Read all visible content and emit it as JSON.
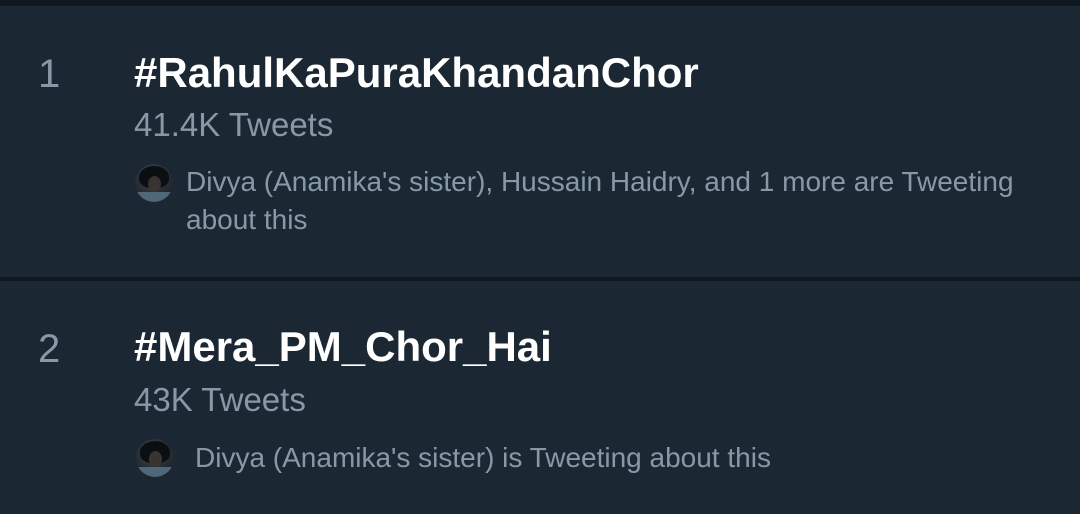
{
  "trends": [
    {
      "rank": "1",
      "hashtag": "#RahulKaPuraKhandanChor",
      "tweet_count": "41.4K Tweets",
      "context": "Divya (Anamika's sister), Hussain Haidry, and 1 more are Tweeting about this",
      "avatar_icon": "user-avatar"
    },
    {
      "rank": "2",
      "hashtag": "#Mera_PM_Chor_Hai",
      "tweet_count": "43K Tweets",
      "context": "Divya (Anamika's sister) is Tweeting about this",
      "avatar_icon": "user-avatar"
    }
  ],
  "colors": {
    "background": "#1b2834",
    "divider": "#0f181f",
    "primary_text": "#ffffff",
    "secondary_text": "#8899a6"
  }
}
